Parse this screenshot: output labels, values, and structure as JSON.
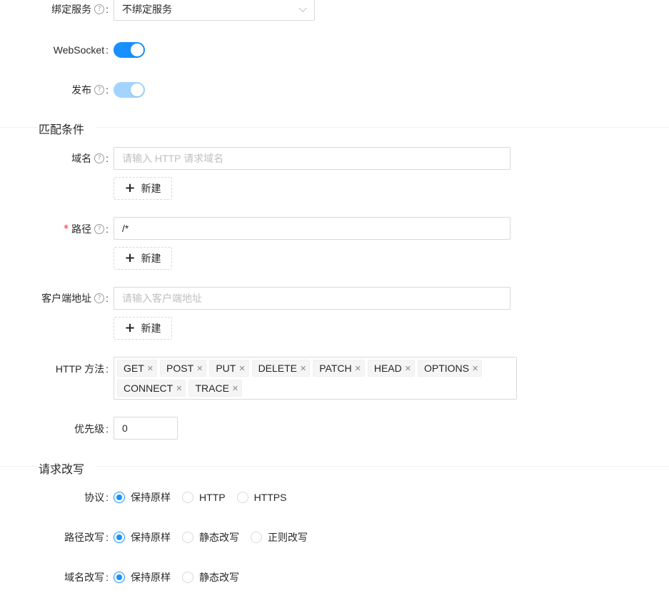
{
  "bind_service": {
    "label": "绑定服务",
    "value": "不绑定服务"
  },
  "websocket": {
    "label": "WebSocket",
    "enabled": true
  },
  "publish": {
    "label": "发布",
    "enabled": true,
    "disabled": true
  },
  "match_section": {
    "title": "匹配条件"
  },
  "domain": {
    "label": "域名",
    "placeholder": "请输入 HTTP 请求域名",
    "add_label": "新建"
  },
  "path": {
    "label": "路径",
    "required_mark": "*",
    "value": "/*",
    "add_label": "新建"
  },
  "client_address": {
    "label": "客户端地址",
    "placeholder": "请输入客户端地址",
    "add_label": "新建"
  },
  "http_methods": {
    "label": "HTTP 方法",
    "tags": [
      "GET",
      "POST",
      "PUT",
      "DELETE",
      "PATCH",
      "HEAD",
      "OPTIONS",
      "CONNECT",
      "TRACE"
    ]
  },
  "priority": {
    "label": "优先级",
    "value": "0"
  },
  "rewrite_section": {
    "title": "请求改写"
  },
  "protocol": {
    "label": "协议",
    "options": [
      "保持原样",
      "HTTP",
      "HTTPS"
    ],
    "selected": "保持原样"
  },
  "path_rewrite": {
    "label": "路径改写",
    "options": [
      "保持原样",
      "静态改写",
      "正则改写"
    ],
    "selected": "保持原样"
  },
  "host_rewrite": {
    "label": "域名改写",
    "options": [
      "保持原样",
      "静态改写"
    ],
    "selected": "保持原样"
  },
  "colors": {
    "primary": "#1890ff",
    "required": "#f5222d"
  }
}
